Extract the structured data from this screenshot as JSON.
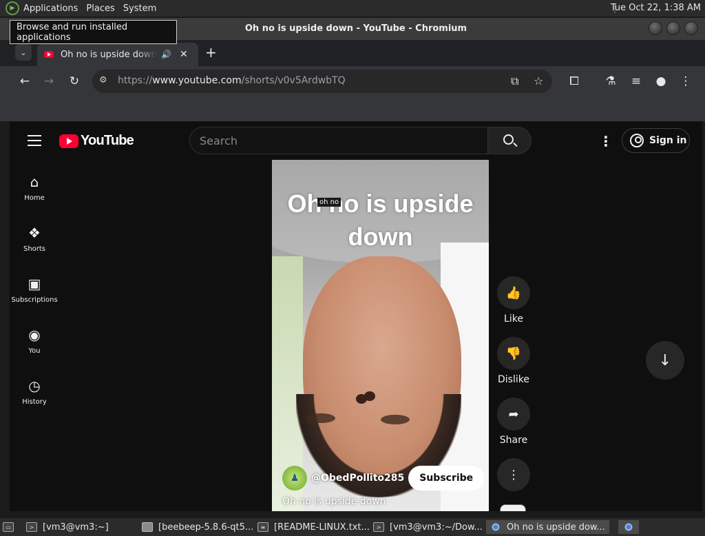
{
  "panel": {
    "menus": [
      "Applications",
      "Places",
      "System"
    ],
    "clock": "Tue Oct 22,  1:38 AM"
  },
  "tooltip": "Browse and run installed applications",
  "window": {
    "title": "Oh no is upside down - YouTube - Chromium"
  },
  "tab": {
    "label": "Oh no is upside down - YouTube",
    "close": "✕"
  },
  "omnibox": {
    "scheme": "https://",
    "host": "www.youtube.com",
    "path": "/shorts/v0v5ArdwbTQ"
  },
  "youtube": {
    "logo_text": "YouTube",
    "search_placeholder": "Search",
    "signin_label": "Sign in",
    "nav": [
      {
        "label": "Home",
        "icon": "home-icon"
      },
      {
        "label": "Shorts",
        "icon": "shorts-icon"
      },
      {
        "label": "Subscriptions",
        "icon": "subscriptions-icon"
      },
      {
        "label": "You",
        "icon": "you-icon"
      },
      {
        "label": "History",
        "icon": "history-icon"
      }
    ],
    "short": {
      "overlay_caption": "Oh no is upside down",
      "chip": "oh no",
      "channel": "@ObedPollito285",
      "subscribe_label": "Subscribe",
      "title": "Oh no is upside down"
    },
    "actions": {
      "like": "Like",
      "dislike": "Dislike",
      "share": "Share"
    }
  },
  "taskbar": [
    {
      "label": "[vm3@vm3:~]",
      "icon": "terminal-icon"
    },
    {
      "label": "[beebeep-5.8.6-qt5...",
      "icon": "folder-icon"
    },
    {
      "label": "[README-LINUX.txt...",
      "icon": "text-file-icon"
    },
    {
      "label": "[vm3@vm3:~/Dow...",
      "icon": "terminal-icon"
    },
    {
      "label": "Oh no is upside dow...",
      "icon": "chromium-icon"
    }
  ],
  "colors": {
    "youtube_red": "#ff0033",
    "page_bg": "#0f0f0f",
    "toolbar": "#35363a"
  }
}
